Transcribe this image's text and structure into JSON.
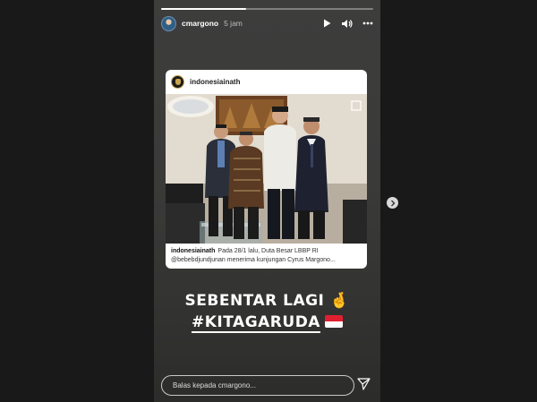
{
  "story": {
    "username": "cmargono",
    "time": "5 jam",
    "progress": 0.4
  },
  "post": {
    "username": "indonesiainath",
    "caption_user": "indonesiainath",
    "caption_line1": "Pada 28/1 lalu, Duta Besar LBBP RI",
    "caption_line2": "@bebebdjundjunan menerima kunjungan Cyrus Margono..."
  },
  "sticker": {
    "line1": "SEBENTAR LAGI",
    "line1_emoji": "🤞",
    "line2": "#KITAGARUDA"
  },
  "reply": {
    "placeholder": "Balas kepada cmargono..."
  },
  "icons": {
    "play": "play-icon",
    "sound": "sound-icon",
    "more": "more-icon",
    "send": "send-icon",
    "next": "chevron-right-icon"
  }
}
